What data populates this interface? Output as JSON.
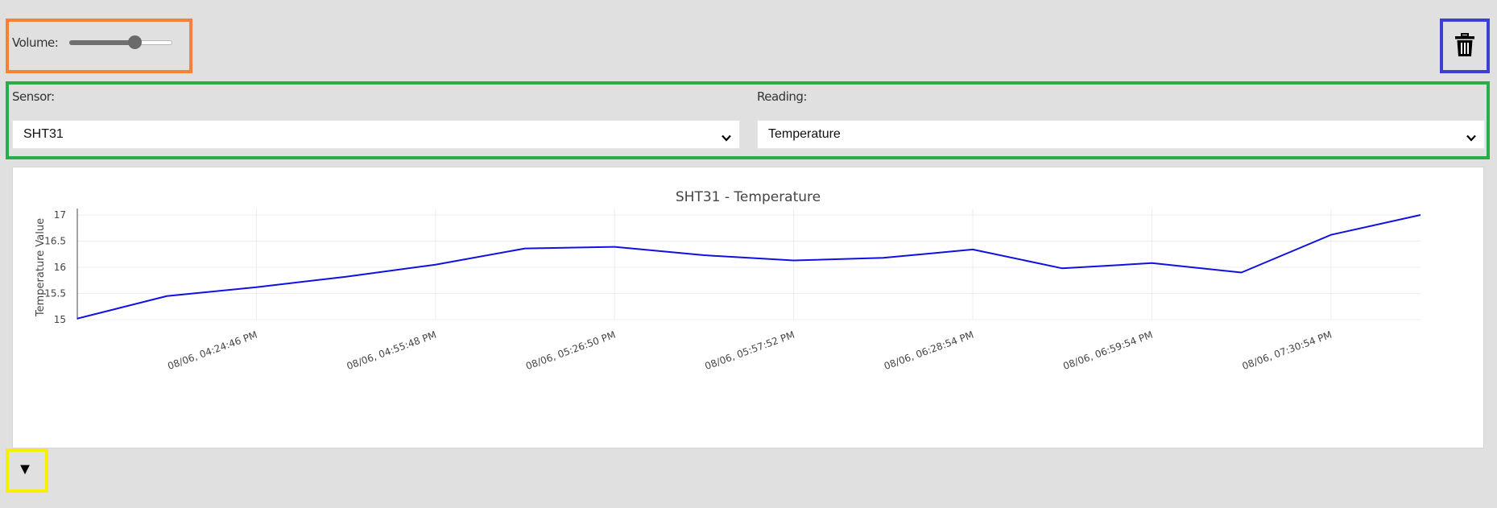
{
  "volume": {
    "label": "Volume:",
    "value_fraction": 0.63
  },
  "icons": {
    "delete": "trash-icon",
    "expand": "triangle-down-icon"
  },
  "sensor": {
    "label": "Sensor:",
    "selected": "SHT31"
  },
  "reading": {
    "label": "Reading:",
    "selected": "Temperature"
  },
  "toggle": {
    "glyph": "▼"
  },
  "highlight_colors": {
    "volume": "#f5813a",
    "delete": "#3c3fcf",
    "selectors": "#27ad4a",
    "toggle": "#f5f000"
  },
  "chart_data": {
    "type": "line",
    "title": "SHT31 - Temperature",
    "xlabel": "",
    "ylabel": "Temperature Value",
    "ylim": [
      15,
      17
    ],
    "yticks": [
      15,
      15.5,
      16,
      16.5,
      17
    ],
    "grid": true,
    "line_color": "#1010e0",
    "xtick_labels": [
      "08/06, 04:24:46 PM",
      "08/06, 04:55:48 PM",
      "08/06, 05:26:50 PM",
      "08/06, 05:57:52 PM",
      "08/06, 06:28:54 PM",
      "08/06, 06:59:54 PM",
      "08/06, 07:30:54 PM"
    ],
    "series": [
      {
        "values": [
          15.02,
          15.45,
          15.62,
          15.82,
          16.05,
          16.36,
          16.39,
          16.23,
          16.13,
          16.18,
          16.34,
          15.98,
          16.08,
          15.9,
          16.62,
          17.0
        ]
      }
    ]
  }
}
